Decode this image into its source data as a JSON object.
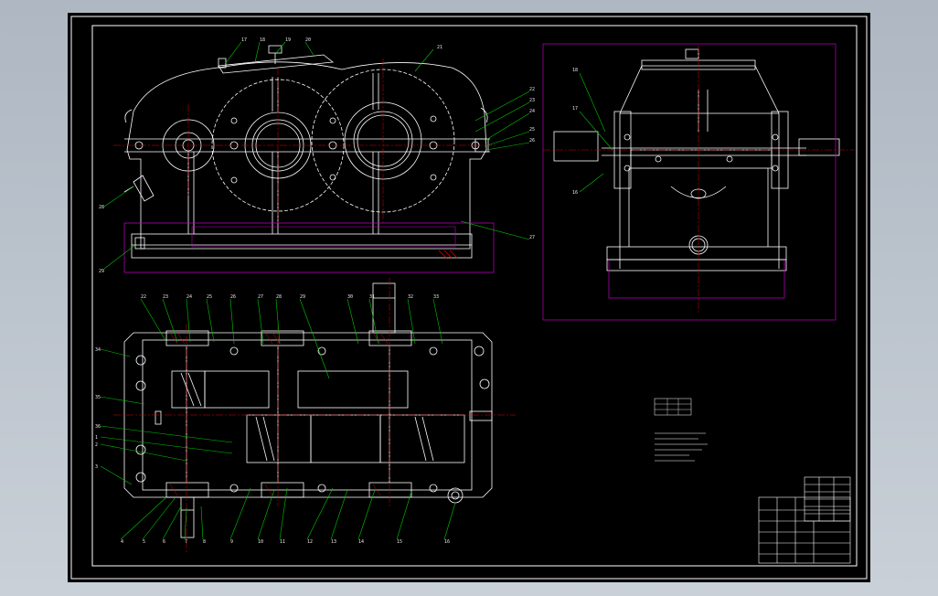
{
  "colors": {
    "background": "#000000",
    "outline": "#ffffff",
    "leader": "#00c800",
    "centerline": "#e00000",
    "hidden": "#c000c0",
    "viewport": "#b9c1cb"
  },
  "front_view_labels": [
    "17",
    "18",
    "19",
    "20",
    "21",
    "22",
    "23",
    "24",
    "25",
    "26",
    "27",
    "28",
    "29"
  ],
  "plan_view_labels": [
    "22",
    "23",
    "24",
    "25",
    "26",
    "27",
    "28",
    "29",
    "30",
    "31",
    "32",
    "33",
    "34",
    "35",
    "36",
    "1",
    "2",
    "3",
    "4",
    "5",
    "6",
    "7",
    "8",
    "9",
    "10",
    "11",
    "12",
    "13",
    "14",
    "15",
    "16"
  ],
  "side_view_labels": [
    "18",
    "17",
    "16"
  ]
}
